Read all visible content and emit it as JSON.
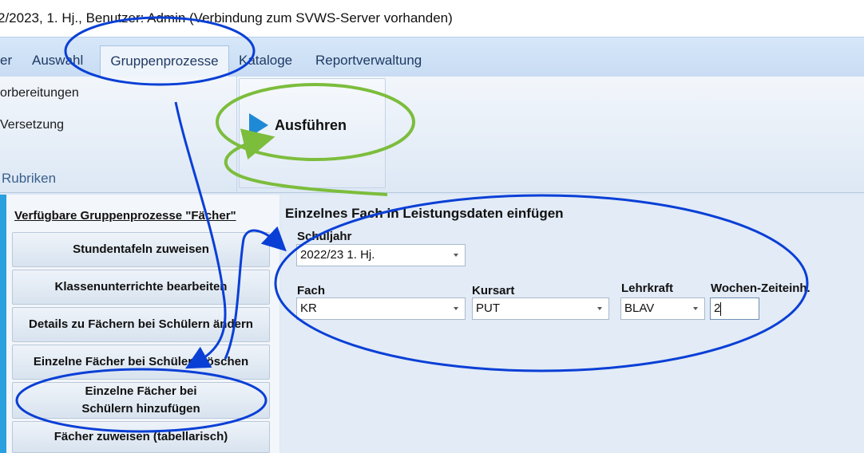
{
  "window": {
    "title": "2/2023, 1. Hj., Benutzer: Admin (Verbindung zum SVWS-Server vorhanden)"
  },
  "menu": {
    "items": [
      {
        "label": "er"
      },
      {
        "label": "Auswahl"
      },
      {
        "label": "Gruppenprozesse",
        "active": true
      },
      {
        "label": "Kataloge"
      },
      {
        "label": "Reportverwaltung"
      }
    ]
  },
  "ribbon": {
    "items": [
      "orbereitungen",
      "Versetzung"
    ],
    "group_label": "Rubriken",
    "run_label": "Ausführen",
    "run_icon": "play-icon"
  },
  "processes": {
    "title": "Verfügbare Gruppenprozesse \"Fächer\"",
    "buttons": [
      {
        "label": "Stundentafeln zuweisen"
      },
      {
        "label": "Klassenunterrichte bearbeiten"
      },
      {
        "label": "Details zu Fächern bei Schülern ändern"
      },
      {
        "label": "Einzelne Fächer bei Schülern löschen"
      },
      {
        "label": "Einzelne Fächer bei Schülern hinzufügen"
      },
      {
        "label": "Fächer zuweisen (tabellarisch)"
      }
    ]
  },
  "form": {
    "title": "Einzelnes Fach in Leistungsdaten einfügen",
    "schuljahr": {
      "label": "Schuljahr",
      "value": "2022/23 1. Hj."
    },
    "fach": {
      "label": "Fach",
      "value": "KR"
    },
    "kursart": {
      "label": "Kursart",
      "value": "PUT"
    },
    "lehrkraft": {
      "label": "Lehrkraft",
      "value": "BLAV"
    },
    "wochenstunden": {
      "label": "Wochen-Zeiteinh.",
      "value": "2"
    }
  },
  "colors": {
    "annotation_blue": "#0a3fd6",
    "annotation_green": "#7cbd3c",
    "accent_stripe": "#2aa0df"
  }
}
